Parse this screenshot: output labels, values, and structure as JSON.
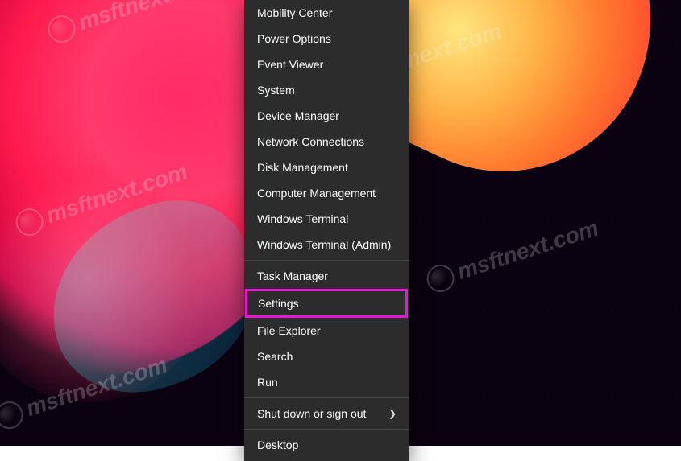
{
  "watermark_text": "msftnext.com",
  "highlight_color": "#e815d7",
  "menu": {
    "items": [
      {
        "label": "Mobility Center"
      },
      {
        "label": "Power Options"
      },
      {
        "label": "Event Viewer"
      },
      {
        "label": "System"
      },
      {
        "label": "Device Manager"
      },
      {
        "label": "Network Connections"
      },
      {
        "label": "Disk Management"
      },
      {
        "label": "Computer Management"
      },
      {
        "label": "Windows Terminal"
      },
      {
        "label": "Windows Terminal (Admin)"
      }
    ],
    "items2": [
      {
        "label": "Task Manager"
      }
    ],
    "highlighted": {
      "label": "Settings"
    },
    "items3": [
      {
        "label": "File Explorer"
      },
      {
        "label": "Search"
      },
      {
        "label": "Run"
      }
    ],
    "items4": [
      {
        "label": "Shut down or sign out",
        "submenu": true
      }
    ],
    "items5": [
      {
        "label": "Desktop"
      }
    ]
  }
}
